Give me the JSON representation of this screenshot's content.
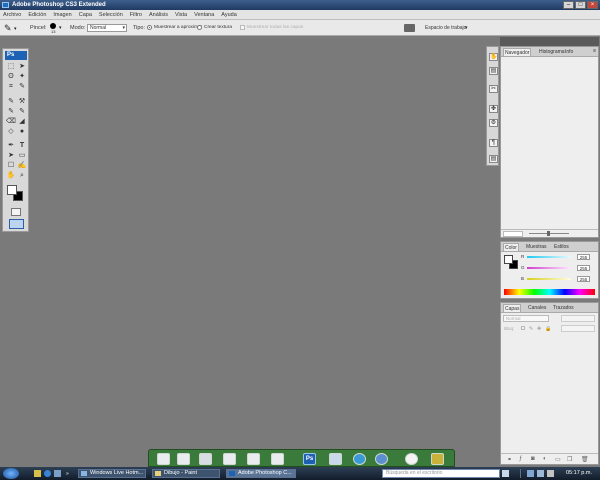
{
  "window": {
    "title": "Adobe Photoshop CS3 Extended"
  },
  "menu": [
    "Archivo",
    "Edición",
    "Imagen",
    "Capa",
    "Selección",
    "Filtro",
    "Análisis",
    "Vista",
    "Ventana",
    "Ayuda"
  ],
  "options": {
    "brush_label": "Pincel:",
    "brush_size": "13",
    "mode_label": "Modo:",
    "mode_value": "Normal",
    "type_label": "Tipo:",
    "type_option1": "Muestrear a aproximar",
    "type_option2": "Crear textura",
    "type_option3": "Muestrear todas las capas",
    "workspace_label": "Espacio de trabajo"
  },
  "tools": {
    "logo": "Ps",
    "glyphs": [
      "⬚",
      "➤",
      "ʘ",
      "✦",
      "⌗",
      "✎",
      "✎",
      "⚒",
      "✎",
      "✎",
      "⌫",
      "◢",
      "◇",
      "●",
      "✒",
      "T",
      "➤",
      "▭",
      "☐",
      "✍",
      "✋",
      "⌕"
    ]
  },
  "dock_icons": [
    "✋",
    "▤",
    "✂",
    "✤",
    "⚙",
    "¶",
    "▤"
  ],
  "navigator": {
    "tabs": [
      "Navegador",
      "Histograma",
      "Info"
    ]
  },
  "color": {
    "tabs": [
      "Color",
      "Muestras",
      "Estilos"
    ],
    "channels": [
      {
        "label": "R",
        "value": "255",
        "color": "#6fd9f5"
      },
      {
        "label": "G",
        "value": "255",
        "color": "#e07ae0"
      },
      {
        "label": "B",
        "value": "255",
        "color": "#e8e46a"
      }
    ]
  },
  "layers": {
    "tabs": [
      "Capas",
      "Canales",
      "Trazados"
    ],
    "blend": "Normal",
    "lock_label": "Bloq:"
  },
  "taskbar": {
    "tasks": [
      "Windows Live Hotm...",
      "Dibujo - Paint",
      "Adobe Photoshop C..."
    ],
    "search_placeholder": "Búsqueda en el escritorio",
    "clock": "05:17 p.m."
  }
}
